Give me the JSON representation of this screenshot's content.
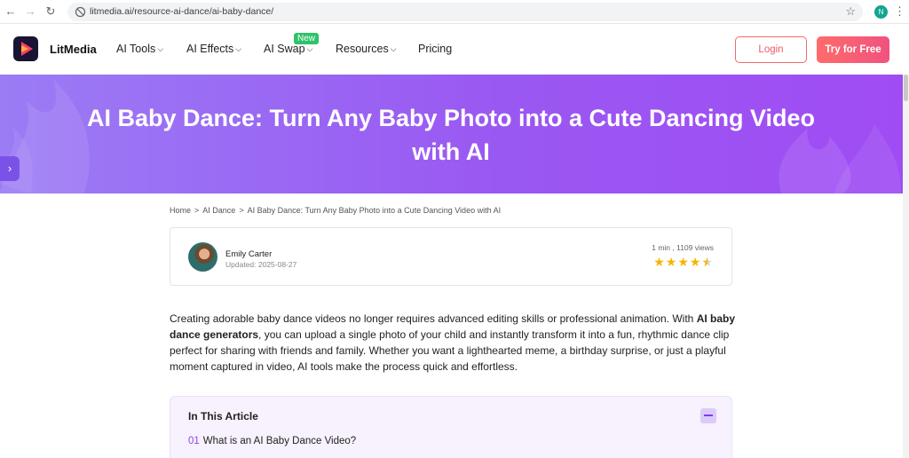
{
  "browser": {
    "url": "litmedia.ai/resource-ai-dance/ai-baby-dance/",
    "profile_initial": "N",
    "back_icon": "arrow-left-icon",
    "forward_icon": "arrow-right-icon",
    "reload_icon": "reload-icon",
    "bookmark_icon": "star-icon",
    "menu_icon": "kebab-menu-icon"
  },
  "header": {
    "brand": "LitMedia",
    "nav": {
      "ai_tools": "AI Tools",
      "ai_effects": "AI Effects",
      "ai_swap": "AI Swap",
      "resources": "Resources",
      "pricing": "Pricing"
    },
    "new_badge": "New",
    "login": "Login",
    "try_free": "Try for Free"
  },
  "hero": {
    "title_line1": "AI Baby Dance: Turn Any Baby Photo into a Cute Dancing Video",
    "title_line2": "with AI"
  },
  "breadcrumb": {
    "home": "Home",
    "sep": ">",
    "ai_dance": "AI Dance",
    "current": "AI Baby Dance: Turn Any Baby Photo into a Cute Dancing Video with AI"
  },
  "author": {
    "name": "Emily Carter",
    "updated": "Updated: 2025-08-27",
    "meta": "1 min , 1109 views",
    "rating": 4.5
  },
  "intro": {
    "part1": "Creating adorable baby dance videos no longer requires advanced editing skills or professional animation. With ",
    "bold": "AI baby dance generators",
    "part2": ", you can upload a single photo of your child and instantly transform it into a fun, rhythmic dance clip perfect for sharing with friends and family. Whether you want a lighthearted meme, a birthday surprise, or just a playful moment captured in video, AI tools make the process quick and effortless."
  },
  "toc": {
    "title": "In This Article",
    "items": [
      {
        "num": "01",
        "label": "What is an AI Baby Dance Video?"
      }
    ]
  },
  "colors": {
    "hero_gradient_start": "#9b7cf5",
    "hero_gradient_end": "#a04cf4",
    "accent_red": "#f05a6a",
    "accent_purple": "#8a47f0",
    "star": "#f7b500"
  }
}
